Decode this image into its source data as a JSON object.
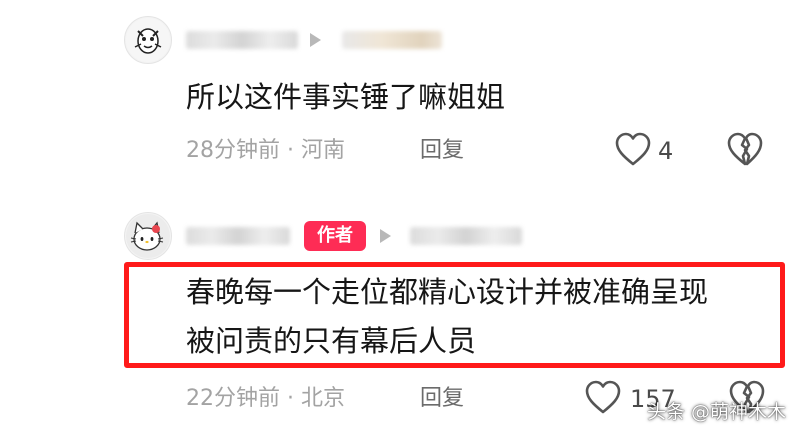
{
  "comments": [
    {
      "text": "所以这件事实锤了嘛姐姐",
      "meta": "28分钟前 · 河南",
      "reply_label": "回复",
      "like_count": "4"
    },
    {
      "author_badge": "作者",
      "text_line1": "春晚每一个走位都精心设计并被准确呈现",
      "text_line2": "被问责的只有幕后人员",
      "meta": "22分钟前 · 北京",
      "reply_label": "回复",
      "like_count": "157"
    }
  ],
  "watermark": "头条 @萌神木木",
  "colors": {
    "author_badge": "#fe2c55",
    "highlight_box": "#ff1a1a",
    "meta_text": "#a3a3a3"
  },
  "icons": [
    "avatar-cartoon",
    "avatar-hello-kitty",
    "reply-arrow-icon",
    "heart-outline-icon",
    "broken-heart-icon"
  ]
}
